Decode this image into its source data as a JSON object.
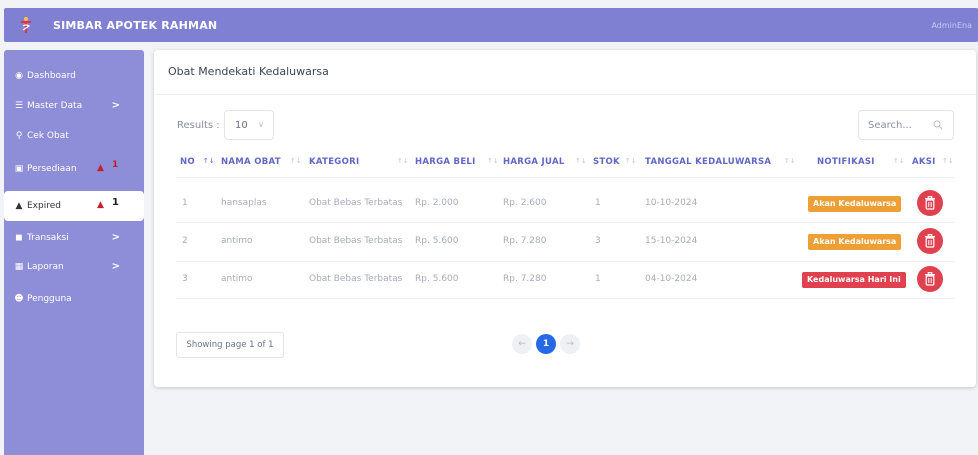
{
  "app": {
    "title": "SIMBAR APOTEK RAHMAN",
    "user": "AdminEna"
  },
  "colors": {
    "header": "#7f80d1",
    "sidebar": "#8e8dd8",
    "accent": "#6067c6",
    "warning": "#eea036",
    "danger": "#e0414f",
    "page_active": "#2569e6"
  },
  "sidebar": {
    "items": [
      {
        "label": "Dashboard",
        "icon": "dashboard-icon"
      },
      {
        "label": "Master Data",
        "icon": "database-icon",
        "chevron": ">"
      },
      {
        "label": "Cek Obat",
        "icon": "search-icon"
      },
      {
        "label": "Persediaan",
        "icon": "inventory-icon",
        "count": "1"
      },
      {
        "label": "Expired",
        "icon": "warning-icon",
        "count": "1"
      },
      {
        "label": "Transaksi",
        "icon": "cart-icon",
        "chevron": ">"
      },
      {
        "label": "Laporan",
        "icon": "report-icon",
        "chevron": ">"
      },
      {
        "label": "Pengguna",
        "icon": "users-icon"
      }
    ]
  },
  "card": {
    "title": "Obat Mendekati Kedaluwarsa",
    "results_label": "Results :",
    "results_value": "10",
    "search_placeholder": "Search..."
  },
  "table": {
    "columns": [
      "NO",
      "NAMA OBAT",
      "KATEGORI",
      "HARGA BELI",
      "HARGA JUAL",
      "STOK",
      "TANGGAL KEDALUWARSA",
      "NOTIFIKASI",
      "AKSI"
    ],
    "rows": [
      {
        "no": "1",
        "nama": "hansaplas",
        "kategori": "Obat Bebas Terbatas",
        "harga_beli": "Rp. 2.000",
        "harga_jual": "Rp. 2.600",
        "stok": "1",
        "tanggal": "10-10-2024",
        "notifikasi": "Akan Kedaluwarsa",
        "status": "warning"
      },
      {
        "no": "2",
        "nama": "antimo",
        "kategori": "Obat Bebas Terbatas",
        "harga_beli": "Rp. 5.600",
        "harga_jual": "Rp. 7.280",
        "stok": "3",
        "tanggal": "15-10-2024",
        "notifikasi": "Akan Kedaluwarsa",
        "status": "warning"
      },
      {
        "no": "3",
        "nama": "antimo",
        "kategori": "Obat Bebas Terbatas",
        "harga_beli": "Rp. 5.600",
        "harga_jual": "Rp. 7.280",
        "stok": "1",
        "tanggal": "04-10-2024",
        "notifikasi": "Kedaluwarsa Hari Ini",
        "status": "danger"
      }
    ]
  },
  "footer": {
    "info": "Showing page 1 of 1",
    "prev": "←",
    "page": "1",
    "next": "→"
  }
}
